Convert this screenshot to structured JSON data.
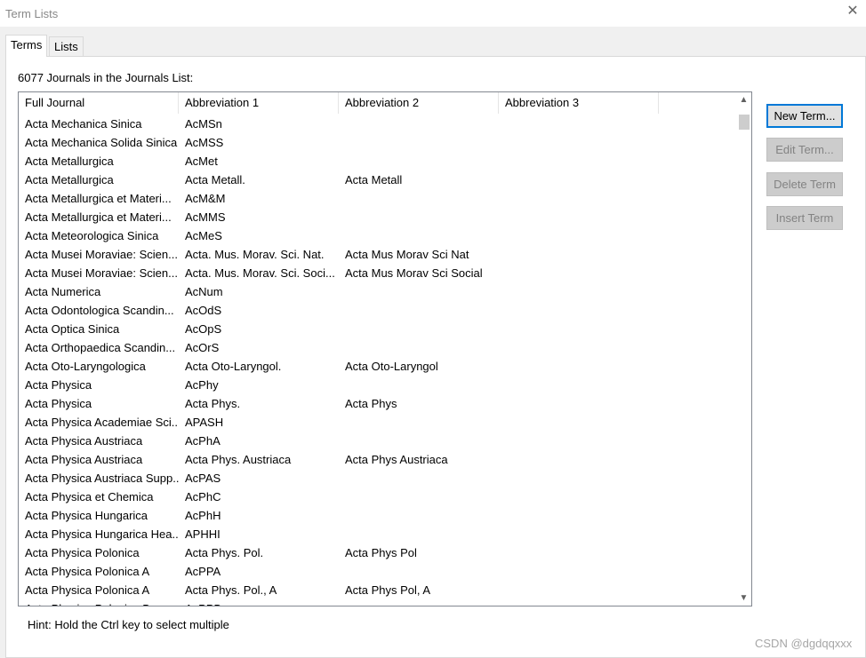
{
  "window": {
    "title": "Term Lists",
    "close_glyph": "✕"
  },
  "tabs": [
    {
      "label": "Terms",
      "active": true
    },
    {
      "label": "Lists",
      "active": false
    }
  ],
  "count_text": "6077 Journals in the Journals List:",
  "columns": [
    "Full Journal",
    "Abbreviation 1",
    "Abbreviation 2",
    "Abbreviation 3"
  ],
  "rows": [
    [
      "Acta Mechanica Sinica",
      "AcMSn",
      "",
      ""
    ],
    [
      "Acta Mechanica Solida Sinica",
      "AcMSS",
      "",
      ""
    ],
    [
      "Acta Metallurgica",
      "AcMet",
      "",
      ""
    ],
    [
      "Acta Metallurgica",
      "Acta Metall.",
      "Acta Metall",
      ""
    ],
    [
      "Acta Metallurgica et Materi...",
      "AcM&M",
      "",
      ""
    ],
    [
      "Acta Metallurgica et Materi...",
      "AcMMS",
      "",
      ""
    ],
    [
      "Acta Meteorologica Sinica",
      "AcMeS",
      "",
      ""
    ],
    [
      "Acta Musei Moraviae: Scien...",
      "Acta. Mus. Morav. Sci. Nat.",
      "Acta Mus Morav Sci Nat",
      ""
    ],
    [
      "Acta Musei Moraviae: Scien...",
      "Acta. Mus. Morav. Sci. Soci...",
      "Acta Mus Morav Sci Social",
      ""
    ],
    [
      "Acta Numerica",
      "AcNum",
      "",
      ""
    ],
    [
      "Acta Odontologica Scandin...",
      "AcOdS",
      "",
      ""
    ],
    [
      "Acta Optica Sinica",
      "AcOpS",
      "",
      ""
    ],
    [
      "Acta Orthopaedica Scandin...",
      "AcOrS",
      "",
      ""
    ],
    [
      "Acta Oto-Laryngologica",
      "Acta Oto-Laryngol.",
      "Acta Oto-Laryngol",
      ""
    ],
    [
      "Acta Physica",
      "AcPhy",
      "",
      ""
    ],
    [
      "Acta Physica",
      "Acta Phys.",
      "Acta Phys",
      ""
    ],
    [
      "Acta Physica Academiae Sci...",
      "APASH",
      "",
      ""
    ],
    [
      "Acta Physica Austriaca",
      "AcPhA",
      "",
      ""
    ],
    [
      "Acta Physica Austriaca",
      "Acta Phys. Austriaca",
      "Acta Phys Austriaca",
      ""
    ],
    [
      "Acta Physica Austriaca Supp...",
      "AcPAS",
      "",
      ""
    ],
    [
      "Acta Physica et Chemica",
      "AcPhC",
      "",
      ""
    ],
    [
      "Acta Physica Hungarica",
      "AcPhH",
      "",
      ""
    ],
    [
      "Acta Physica Hungarica Hea...",
      "APHHI",
      "",
      ""
    ],
    [
      "Acta Physica Polonica",
      "Acta Phys. Pol.",
      "Acta Phys Pol",
      ""
    ],
    [
      "Acta Physica Polonica A",
      "AcPPA",
      "",
      ""
    ],
    [
      "Acta Physica Polonica A",
      "Acta Phys. Pol., A",
      "Acta Phys Pol, A",
      ""
    ],
    [
      "Acta Physica Polonica B",
      "AcPPB",
      "",
      ""
    ]
  ],
  "buttons": {
    "new_term": "New Term...",
    "edit_term": "Edit Term...",
    "delete_term": "Delete Term",
    "insert_term": "Insert Term"
  },
  "hint": "Hint: Hold the Ctrl key to select multiple",
  "watermark": "CSDN @dgdqqxxx",
  "scroll_arrows": {
    "up": "▲",
    "down": "▼"
  }
}
